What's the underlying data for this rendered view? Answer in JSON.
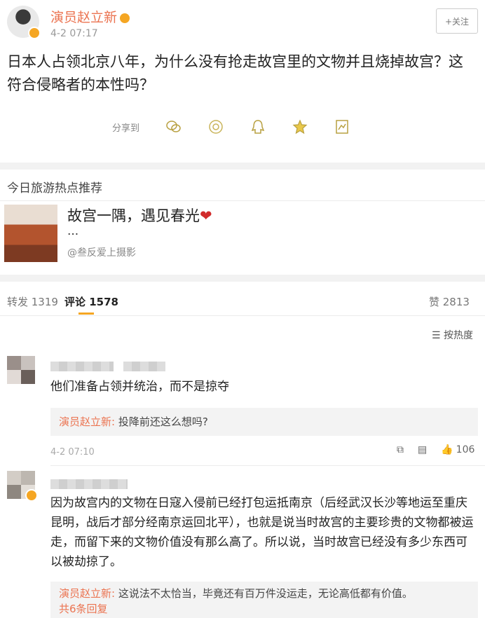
{
  "post": {
    "author": "演员赵立新",
    "time": "4-2 07:17",
    "follow_label": "+关注",
    "content": "日本人占领北京八年，为什么没有抢走故宫里的文物并且烧掉故宫？这符合侵略者的本性吗？",
    "share_label": "分享到",
    "share_icons": [
      "wechat-icon",
      "moments-icon",
      "qq-icon",
      "qzone-icon",
      "bookmark-icon"
    ]
  },
  "recommend": {
    "title": "今日旅游热点推荐",
    "headline": "故宫一隅，遇见春光",
    "dots": "...",
    "source": "@叁反爱上摄影"
  },
  "tabs": {
    "repost": "转发 1319",
    "comments": "评论 1578",
    "likes": "赞 2813",
    "sort": "按热度"
  },
  "comments": [
    {
      "text": "他们准备占领并统治，而不是掠夺",
      "reply_name": "演员赵立新:",
      "reply_text": "投降前还这么想吗?",
      "time": "4-2 07:10",
      "likes": "106"
    },
    {
      "text": "因为故宫内的文物在日寇入侵前已经打包运抵南京（后经武汉长沙等地运至重庆昆明，战后才部分经南京运回北平），也就是说当时故宫的主要珍贵的文物都被运走，而留下来的文物价值没有那么高了。所以说，当时故宫已经没有多少东西可以被劫掠了。",
      "reply_name": "演员赵立新:",
      "reply_text": "这说法不太恰当，毕竟还有百万件没运走，无论高低都有价值。",
      "more": "共6条回复"
    }
  ],
  "colors": {
    "accent": "#eb7350",
    "tab_underline": "#f5a623"
  }
}
